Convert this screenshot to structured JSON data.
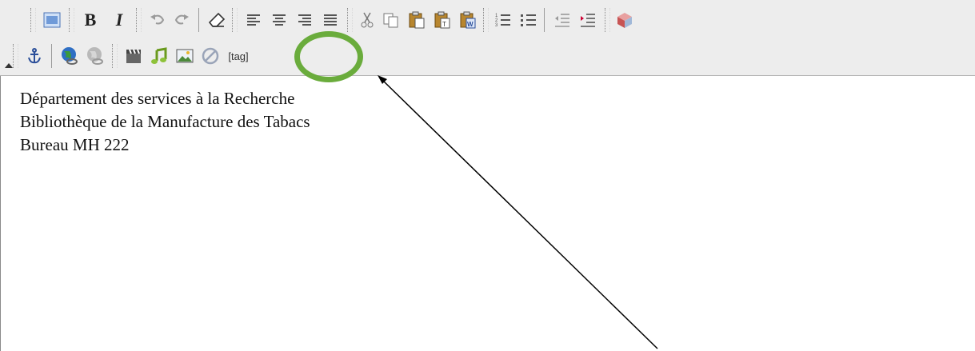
{
  "toolbar": {
    "row1": [
      {
        "name": "source-button",
        "icon": "source-window-icon"
      },
      {
        "name": "bold-button",
        "label": "B"
      },
      {
        "name": "italic-button",
        "label": "I"
      },
      {
        "name": "undo-button",
        "icon": "undo-icon"
      },
      {
        "name": "redo-button",
        "icon": "redo-icon"
      },
      {
        "name": "eraser-button",
        "icon": "eraser-icon"
      },
      {
        "name": "align-left-button",
        "icon": "align-left-icon"
      },
      {
        "name": "align-center-button",
        "icon": "align-center-icon"
      },
      {
        "name": "align-right-button",
        "icon": "align-right-icon"
      },
      {
        "name": "justify-button",
        "icon": "justify-icon"
      },
      {
        "name": "cut-button",
        "icon": "scissors-icon"
      },
      {
        "name": "copy-button",
        "icon": "copy-icon"
      },
      {
        "name": "paste-button",
        "icon": "paste-icon"
      },
      {
        "name": "paste-text-button",
        "icon": "paste-text-icon"
      },
      {
        "name": "paste-word-button",
        "icon": "paste-word-icon"
      },
      {
        "name": "numbered-list-button",
        "icon": "numbered-list-icon"
      },
      {
        "name": "bullet-list-button",
        "icon": "bullet-list-icon"
      },
      {
        "name": "outdent-button",
        "icon": "outdent-icon"
      },
      {
        "name": "indent-button",
        "icon": "indent-icon"
      },
      {
        "name": "special-char-button",
        "icon": "cube-icon"
      }
    ],
    "row2": [
      {
        "name": "anchor-button",
        "icon": "anchor-icon"
      },
      {
        "name": "link-button",
        "icon": "globe-link-icon"
      },
      {
        "name": "unlink-button",
        "icon": "globe-unlink-icon"
      },
      {
        "name": "video-button",
        "icon": "clapperboard-icon"
      },
      {
        "name": "audio-button",
        "icon": "music-icon"
      },
      {
        "name": "image-button",
        "icon": "image-icon"
      },
      {
        "name": "no-entry-button",
        "icon": "no-entry-icon"
      },
      {
        "name": "tag-button",
        "label": "[tag]"
      }
    ],
    "colors": {
      "highlight_circle": "#6aac3c",
      "toolbar_bg": "#ededed",
      "icon_blue": "#4a73b6"
    }
  },
  "editor": {
    "lines": [
      "Département des services à la Recherche",
      "Bibliothèque de la Manufacture des Tabacs",
      "Bureau MH 222"
    ]
  }
}
